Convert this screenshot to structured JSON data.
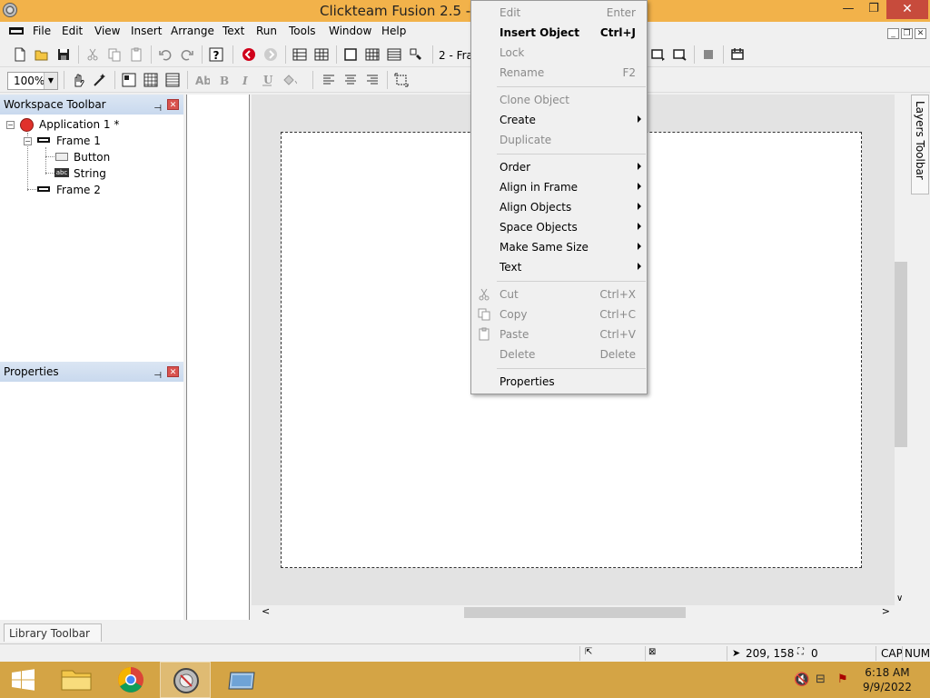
{
  "window": {
    "title": "Clickteam Fusion 2.5 - [Ap",
    "min_glyph": "—",
    "max_glyph": "❐",
    "close_glyph": "✕"
  },
  "menubar": {
    "items": [
      "File",
      "Edit",
      "View",
      "Insert",
      "Arrange",
      "Text",
      "Run",
      "Tools",
      "Window",
      "Help"
    ],
    "mdi_min": "_",
    "mdi_restore": "❐",
    "mdi_close": "✕"
  },
  "toolbar": {
    "frame_select": "2 - Fra",
    "zoom": "100%"
  },
  "workspace": {
    "title": "Workspace Toolbar",
    "pin_glyph": "⊣",
    "close_glyph": "✕",
    "tree": {
      "application": "Application 1 *",
      "frame1": "Frame 1",
      "button": "Button",
      "string": "String",
      "frame2": "Frame 2",
      "abc": "abc"
    }
  },
  "properties": {
    "title": "Properties"
  },
  "layers_toolbar": "Layers Toolbar",
  "library_toolbar": "Library Toolbar",
  "status": {
    "coords": "209, 158",
    "objects": "0",
    "caps": "CAP",
    "num": "NUM"
  },
  "clock": {
    "time": "6:18 AM",
    "date": "9/9/2022"
  },
  "context_menu": {
    "items": [
      {
        "label": "Edit",
        "shortcut": "Enter",
        "disabled": true
      },
      {
        "label": "Insert Object",
        "shortcut": "Ctrl+J",
        "bold": true
      },
      {
        "label": "Lock",
        "shortcut": "",
        "disabled": true
      },
      {
        "label": "Rename",
        "shortcut": "F2",
        "disabled": true
      },
      {
        "label": "Clone Object",
        "shortcut": "",
        "disabled": true
      },
      {
        "label": "Create",
        "submenu": true
      },
      {
        "label": "Duplicate",
        "disabled": true
      },
      {
        "label": "Order",
        "submenu": true
      },
      {
        "label": "Align in Frame",
        "submenu": true
      },
      {
        "label": "Align Objects",
        "submenu": true
      },
      {
        "label": "Space Objects",
        "submenu": true
      },
      {
        "label": "Make Same Size",
        "submenu": true
      },
      {
        "label": "Text",
        "submenu": true
      },
      {
        "label": "Cut",
        "shortcut": "Ctrl+X",
        "disabled": true,
        "icon": "scissors-icon"
      },
      {
        "label": "Copy",
        "shortcut": "Ctrl+C",
        "disabled": true,
        "icon": "copy-icon"
      },
      {
        "label": "Paste",
        "shortcut": "Ctrl+V",
        "disabled": true,
        "icon": "paste-icon"
      },
      {
        "label": "Delete",
        "shortcut": "Delete",
        "disabled": true
      },
      {
        "label": "Properties"
      }
    ]
  },
  "colors": {
    "titlebar": "#f2b24a",
    "taskbar": "#d4a445",
    "close_button": "#c74b3c",
    "panel_header": "#c9d9ee"
  }
}
